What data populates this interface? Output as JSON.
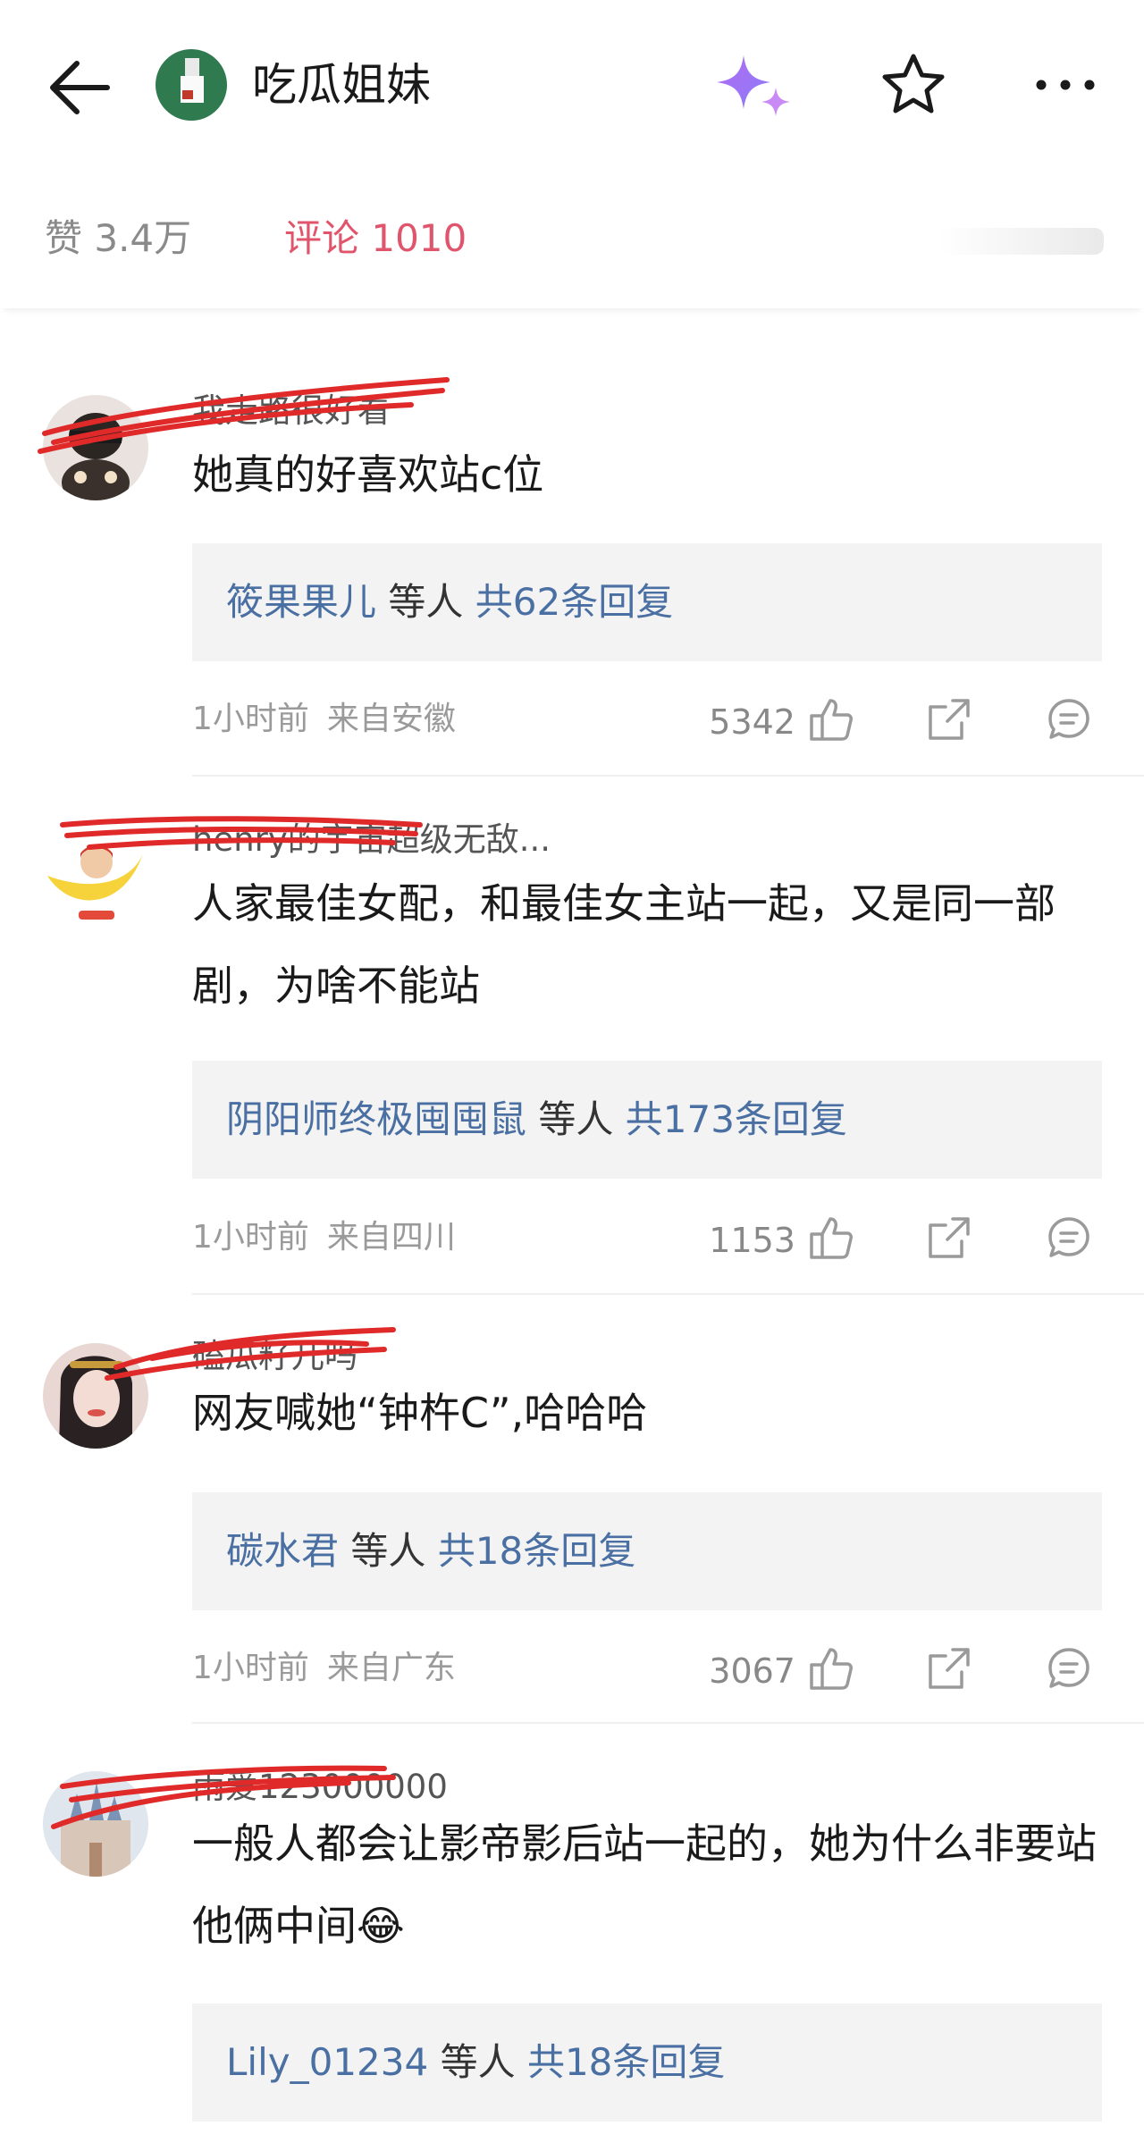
{
  "header": {
    "channel_title": "吃瓜姐妹",
    "icons": [
      "back-arrow-icon",
      "sparkle-icon",
      "star-icon",
      "more-icon"
    ],
    "accent_color": "#e0556b"
  },
  "tabs": {
    "likes": "赞 3.4万",
    "comments": "评论 1010"
  },
  "comments": [
    {
      "username": "我走路很好看",
      "text": "她真的好喜欢站c位",
      "reply_user": "筱果果儿",
      "reply_mid": "等人",
      "reply_count": "共62条回复",
      "time": "1小时前",
      "location": "来自安徽",
      "likes": "5342"
    },
    {
      "username": "henry的宇宙超级无敌...",
      "text": "人家最佳女配，和最佳女主站一起，又是同一部剧，为啥不能站",
      "reply_user": "阴阳师终极囤囤鼠",
      "reply_mid": "等人",
      "reply_count": "共173条回复",
      "time": "1小时前",
      "location": "来自四川",
      "likes": "1153"
    },
    {
      "username": "磕瓜籽儿吗",
      "text": "网友喊她“钟杵C”,哈哈哈",
      "reply_user": "碳水君",
      "reply_mid": "等人",
      "reply_count": "共18条回复",
      "time": "1小时前",
      "location": "来自广东",
      "likes": "3067"
    },
    {
      "username": "雨爱123000000",
      "text": "一般人都会让影帝影后站一起的，她为什么非要站他俩中间😂",
      "reply_user": "Lily_01234",
      "reply_mid": "等人",
      "reply_count": "共18条回复"
    }
  ]
}
